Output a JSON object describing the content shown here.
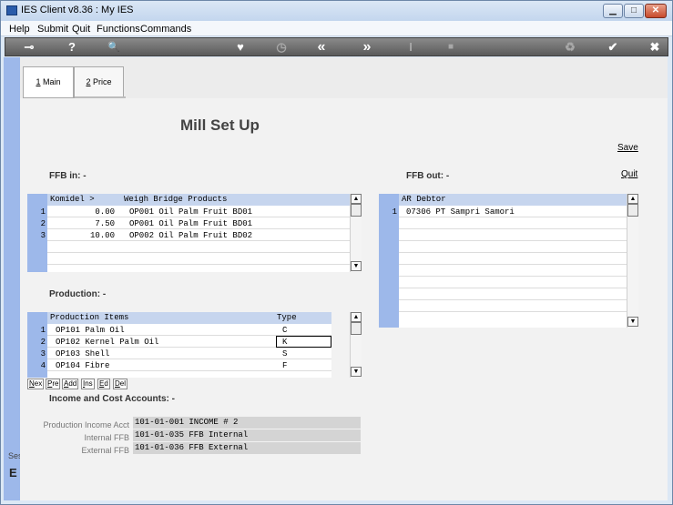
{
  "window": {
    "title": "IES Client v8.36 : My IES"
  },
  "menu": [
    "Help",
    "Submit",
    "Quit",
    "Functions",
    "Commands"
  ],
  "toolbar": {
    "icons": [
      "key-icon",
      "help-icon",
      "search-icon",
      "heart-icon",
      "clock-icon",
      "rewind-icon",
      "fast-forward-icon",
      "text-cursor-icon",
      "stop-icon",
      "recycle-icon",
      "check-icon",
      "close-icon"
    ],
    "glyphs": [
      "⊸",
      "?",
      "🔍",
      "♥",
      "◷",
      "«",
      "»",
      "I",
      "■",
      "♻",
      "✔",
      "✖"
    ]
  },
  "tabs": [
    {
      "key": "1",
      "label": " Main"
    },
    {
      "key": "2",
      "label": " Price"
    }
  ],
  "page": {
    "title": "Mill Set Up",
    "save_label": "Save",
    "quit_label": "Quit"
  },
  "ffb_in": {
    "label": "FFB in: -",
    "headers": [
      "Komidel >",
      "Weigh Bridge Products"
    ],
    "rows": [
      {
        "num": "1",
        "komidel": "0.00",
        "product": "OP001 Oil Palm Fruit BD01"
      },
      {
        "num": "2",
        "komidel": "7.50",
        "product": "OP001 Oil Palm Fruit BD01"
      },
      {
        "num": "3",
        "komidel": "10.00",
        "product": "OP002 Oil Palm Fruit BD02"
      }
    ]
  },
  "ffb_out": {
    "label": "FFB out: -",
    "headers": [
      "AR Debtor"
    ],
    "rows": [
      {
        "num": "1",
        "debtor": "07306 PT Sampri Samori"
      }
    ]
  },
  "production": {
    "label": "Production: -",
    "headers": [
      "Production Items",
      "Type"
    ],
    "rows": [
      {
        "num": "1",
        "item": "OP101 Palm Oil",
        "type": "C"
      },
      {
        "num": "2",
        "item": "OP102 Kernel Palm Oil",
        "type": "K"
      },
      {
        "num": "3",
        "item": "OP103 Shell",
        "type": "S"
      },
      {
        "num": "4",
        "item": "OP104 Fibre",
        "type": "F"
      }
    ]
  },
  "nav_buttons": [
    {
      "u": "N",
      "rest": "ex"
    },
    {
      "u": "P",
      "rest": "re"
    },
    {
      "u": "A",
      "rest": "dd"
    },
    {
      "u": "I",
      "rest": "ns"
    },
    {
      "u": "E",
      "rest": "d"
    },
    {
      "u": "D",
      "rest": "el"
    }
  ],
  "accounts": {
    "label": "Income and Cost Accounts: -",
    "fields": [
      {
        "label": "Production Income Acct",
        "value": "101-01-001 INCOME # 2"
      },
      {
        "label": "Internal FFB",
        "value": "101-01-035 FFB Internal"
      },
      {
        "label": "External FFB",
        "value": "101-01-036 FFB External"
      }
    ]
  },
  "side": {
    "ses": "Ses",
    "e": "E"
  }
}
